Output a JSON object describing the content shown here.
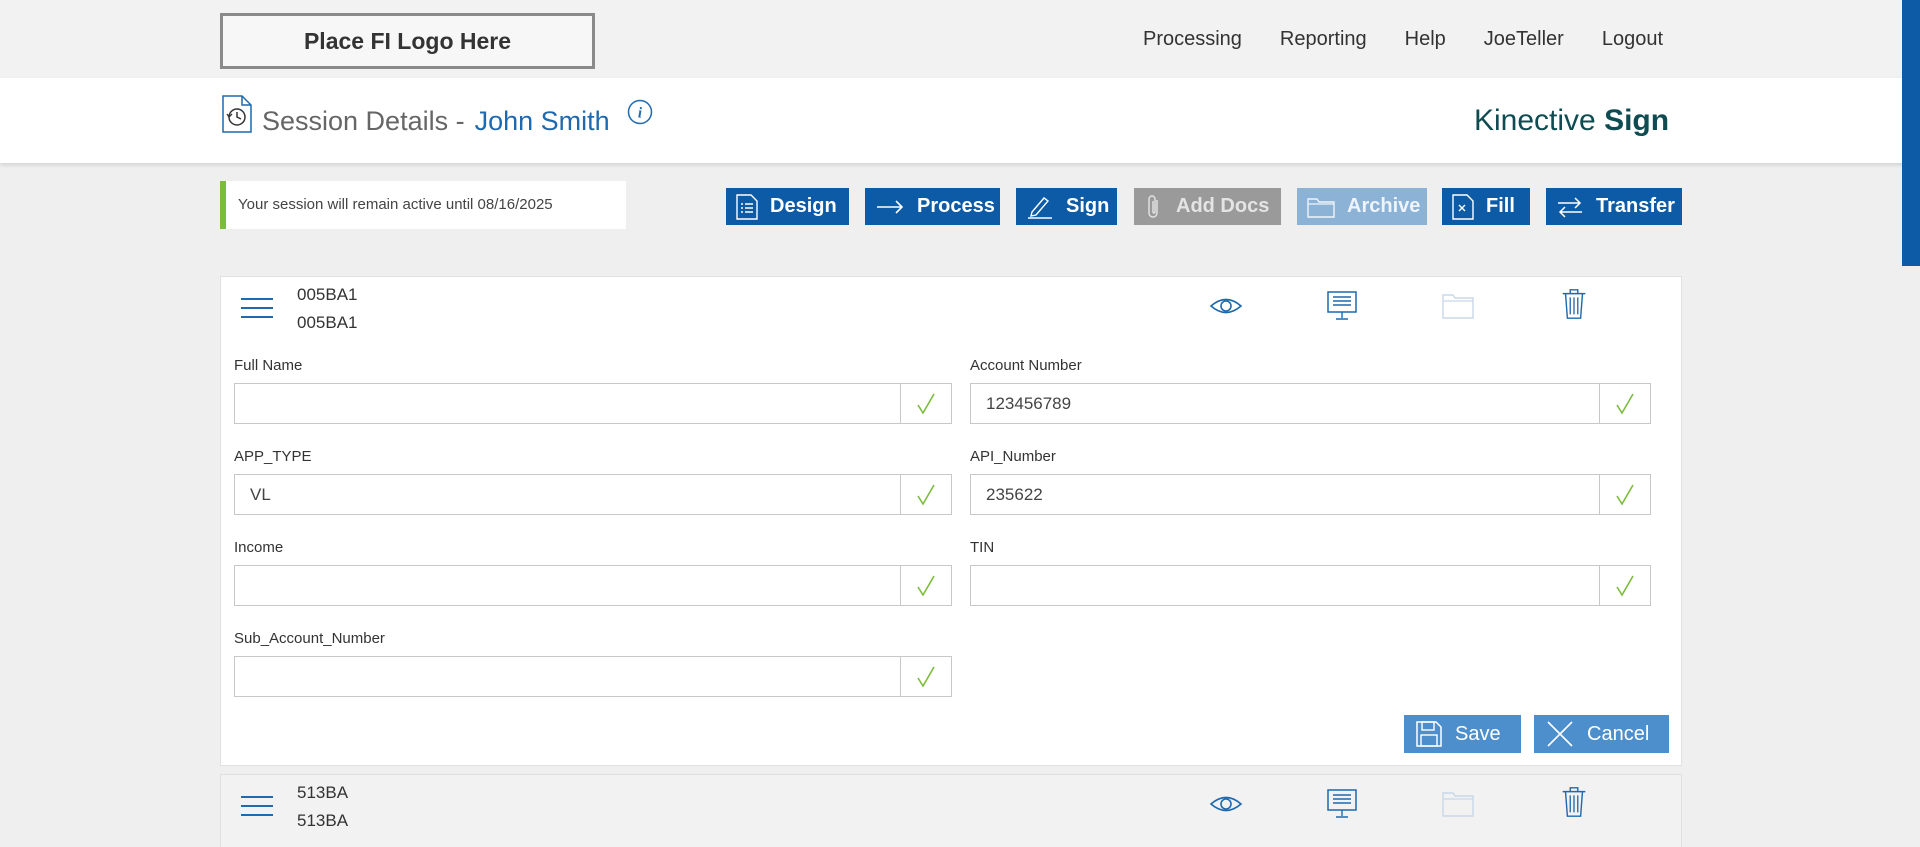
{
  "logo": "Place FI Logo Here",
  "nav": [
    "Processing",
    "Reporting",
    "Help",
    "JoeTeller",
    "Logout"
  ],
  "header": {
    "title": "Session Details -",
    "customer": "John Smith",
    "brand_regular": "Kinective",
    "brand_bold": "Sign"
  },
  "notice": "Your session will remain active until 08/16/2025",
  "toolbar": {
    "design": "Design",
    "process": "Process",
    "sign": "Sign",
    "add_docs": "Add Docs",
    "archive": "Archive",
    "fill": "Fill",
    "transfer": "Transfer"
  },
  "doc1": {
    "code1": "005BA1",
    "code2": "005BA1",
    "fields": {
      "full_name": {
        "label": "Full Name",
        "value": ""
      },
      "account_number": {
        "label": "Account Number",
        "value": "123456789"
      },
      "app_type": {
        "label": "APP_TYPE",
        "value": "VL"
      },
      "api_number": {
        "label": "API_Number",
        "value": "235622"
      },
      "income": {
        "label": "Income",
        "value": ""
      },
      "tin": {
        "label": "TIN",
        "value": ""
      },
      "sub_account_number": {
        "label": "Sub_Account_Number",
        "value": ""
      }
    },
    "save": "Save",
    "cancel": "Cancel"
  },
  "doc2": {
    "code1": "513BA",
    "code2": "513BA"
  },
  "colors": {
    "primary": "#0d5aa7",
    "accent_green": "#7bbd3b",
    "link_blue": "#1f69ae",
    "brand": "#0f4c52"
  },
  "icons": [
    "history-doc-icon",
    "info-icon",
    "design-icon",
    "arrow-right-icon",
    "pen-icon",
    "paperclip-icon",
    "folder-icon",
    "fill-doc-icon",
    "transfer-icon",
    "hamburger-icon",
    "eye-icon",
    "monitor-icon",
    "trash-icon",
    "check-icon",
    "save-icon",
    "close-icon"
  ]
}
